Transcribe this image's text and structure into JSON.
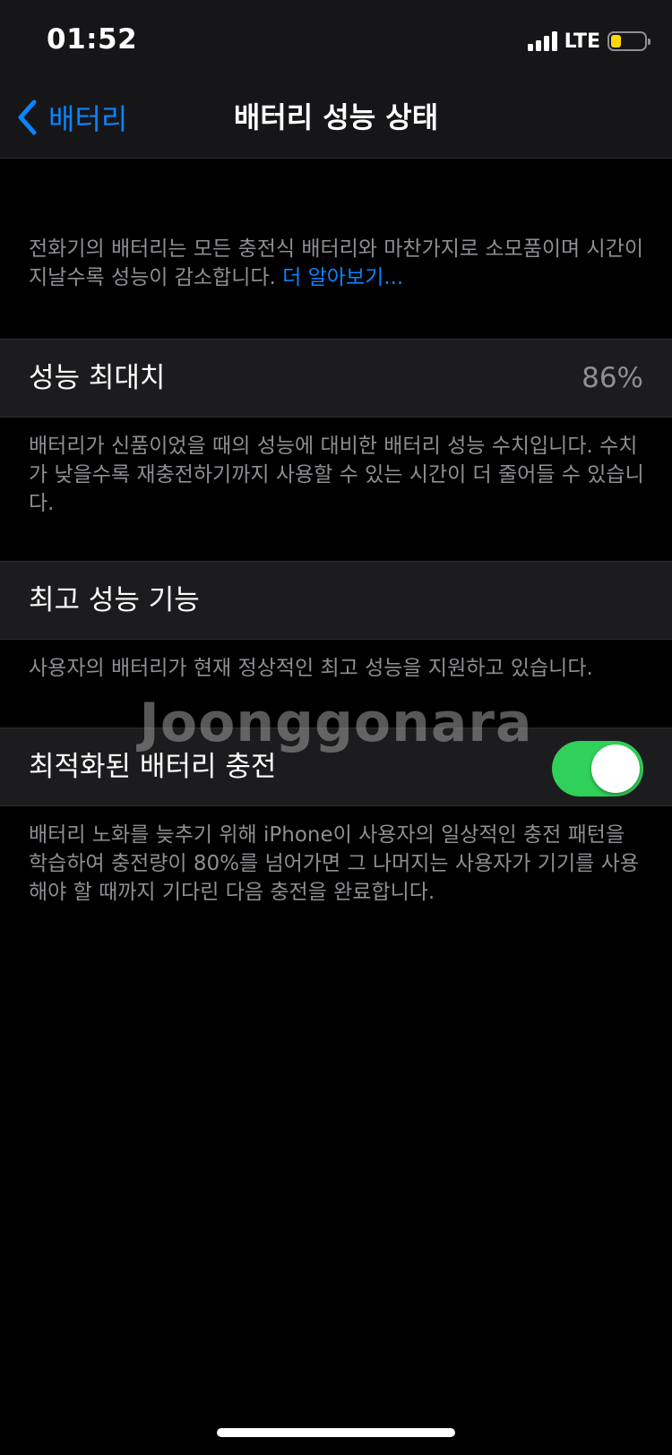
{
  "status_bar": {
    "time": "01:52",
    "network": "LTE",
    "battery_level": 0.3,
    "battery_color": "#ffd60a"
  },
  "nav": {
    "back_label": "배터리",
    "title": "배터리 성능 상태"
  },
  "intro": {
    "text": "전화기의 배터리는 모든 충전식 배터리와 마찬가지로 소모품이며 시간이 지날수록 성능이 감소합니다. ",
    "link": "더 알아보기..."
  },
  "max_capacity": {
    "label": "성능 최대치",
    "value": "86%",
    "description": "배터리가 신품이었을 때의 성능에 대비한 배터리 성능 수치입니다. 수치가 낮을수록 재충전하기까지 사용할 수 있는 시간이 더 줄어들 수 있습니다."
  },
  "peak_performance": {
    "label": "최고 성능 기능",
    "description": "사용자의 배터리가 현재 정상적인 최고 성능을 지원하고 있습니다."
  },
  "optimized_charging": {
    "label": "최적화된 배터리 충전",
    "enabled": true,
    "description": "배터리 노화를 늦추기 위해 iPhone이 사용자의 일상적인 충전 패턴을 학습하여 충전량이 80%를 넘어가면 그 나머지는 사용자가 기기를 사용해야 할 때까지 기다린 다음 충전을 완료합니다."
  },
  "watermark": "Joonggonara",
  "colors": {
    "accent": "#0a84ff",
    "toggle_on": "#30d158",
    "background": "#000000",
    "cell": "#1c1c1e",
    "secondary_text": "#8e8e93"
  }
}
